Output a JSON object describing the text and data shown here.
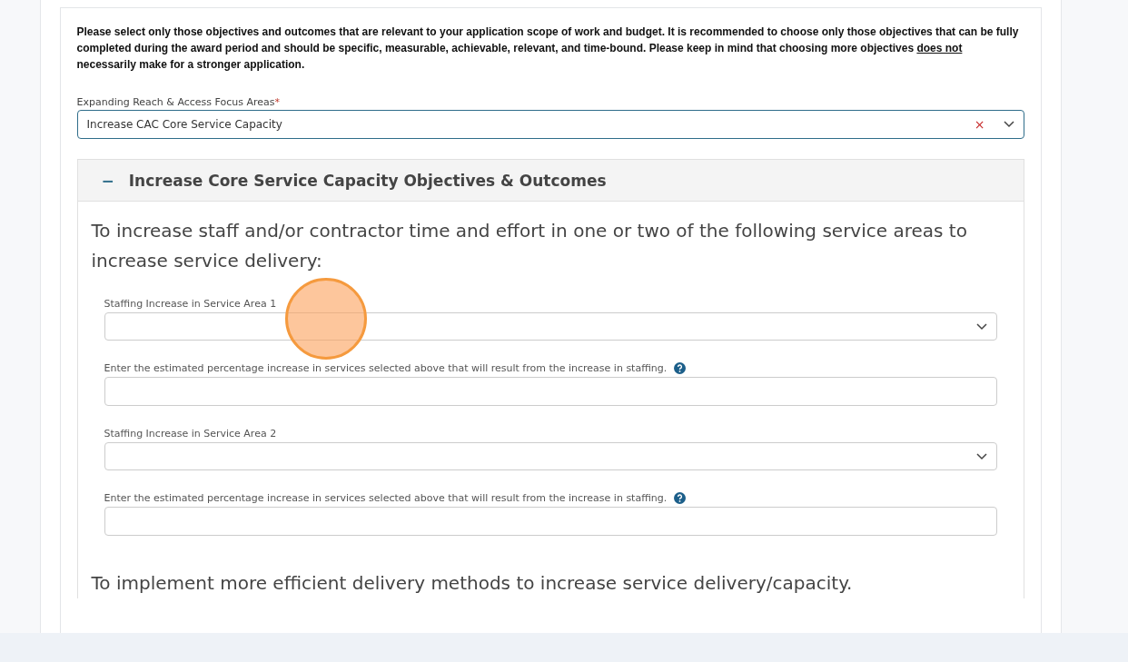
{
  "intro": {
    "before": "Please select only those objectives and outcomes that are relevant to your application scope of work and budget. It is recommended to choose only those objectives that can be fully completed during the award period and should be specific, measurable, achievable, relevant, and time-bound. Please keep in mind that choosing more objectives ",
    "underlined": "does not",
    "after": " necessarily make for a stronger application."
  },
  "focus_field": {
    "label": "Expanding Reach & Access Focus Areas",
    "required_mark": "*",
    "value": "Increase CAC Core Service Capacity",
    "clear": "×"
  },
  "section": {
    "toggle": "−",
    "title": "Increase Core Service Capacity Objectives & Outcomes",
    "groups": [
      {
        "heading": "To increase staff and/or contractor time and effort in one or two of the following service areas to increase service delivery:",
        "fields": [
          {
            "kind": "select",
            "label": "Staffing Increase in Service Area 1",
            "help": false
          },
          {
            "kind": "text",
            "label": "Enter the estimated percentage increase in services selected above that will result from the increase in staffing.",
            "help": true
          },
          {
            "kind": "select",
            "label": "Staffing Increase in Service Area 2",
            "help": false
          },
          {
            "kind": "text",
            "label": "Enter the estimated percentage increase in services selected above that will result from the increase in staffing.",
            "help": true
          }
        ]
      },
      {
        "heading": "To implement more efficient delivery methods to increase service delivery/capacity."
      }
    ]
  }
}
